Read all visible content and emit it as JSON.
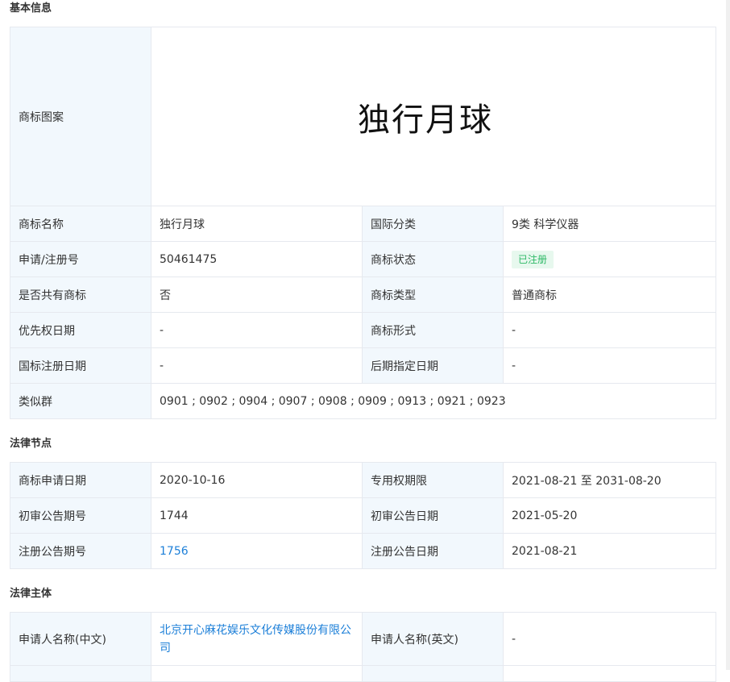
{
  "basic": {
    "title": "基本信息",
    "logo_label": "商标图案",
    "logo_text": "独行月球",
    "rows": [
      {
        "l1": "商标名称",
        "v1": "独行月球",
        "l2": "国际分类",
        "v2": "9类 科学仪器"
      },
      {
        "l1": "申请/注册号",
        "v1": "50461475",
        "l2": "商标状态",
        "v2": "已注册"
      },
      {
        "l1": "是否共有商标",
        "v1": "否",
        "l2": "商标类型",
        "v2": "普通商标"
      },
      {
        "l1": "优先权日期",
        "v1": "-",
        "l2": "商标形式",
        "v2": "-"
      },
      {
        "l1": "国标注册日期",
        "v1": "-",
        "l2": "后期指定日期",
        "v2": "-"
      }
    ],
    "similar_label": "类似群",
    "similar_value": "0901 ; 0902 ; 0904 ; 0907 ; 0908 ; 0909 ; 0913 ; 0921 ; 0923"
  },
  "legal": {
    "title": "法律节点",
    "rows": [
      {
        "l1": "商标申请日期",
        "v1": "2020-10-16",
        "l2": "专用权期限",
        "v2": "2021-08-21 至 2031-08-20"
      },
      {
        "l1": "初审公告期号",
        "v1": "1744",
        "l2": "初审公告日期",
        "v2": "2021-05-20"
      },
      {
        "l1": "注册公告期号",
        "v1": "1756",
        "l2": "注册公告日期",
        "v2": "2021-08-21"
      }
    ]
  },
  "subject": {
    "title": "法律主体",
    "rows": [
      {
        "l1": "申请人名称(中文)",
        "v1": "北京开心麻花娱乐文化传媒股份有限公司",
        "l2": "申请人名称(英文)",
        "v2": "-"
      }
    ]
  },
  "colors": {
    "label_bg": "#f2f8fd",
    "border": "#e6e9ef",
    "link": "#1c7fd8",
    "badge_fg": "#2db966",
    "badge_bg": "#e7f8ee"
  }
}
